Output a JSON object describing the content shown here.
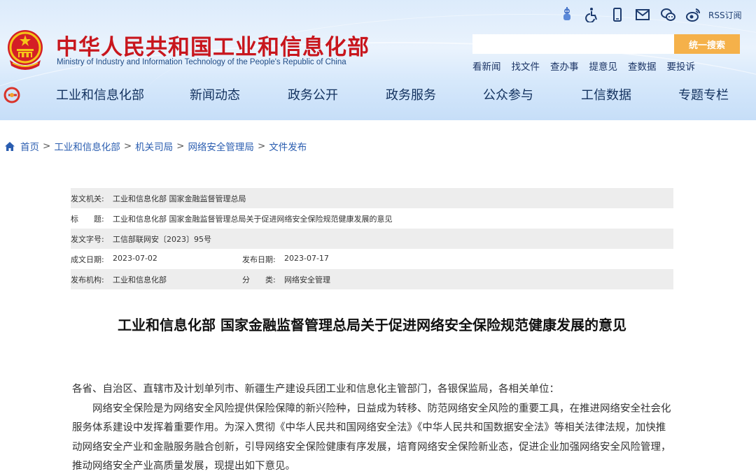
{
  "header": {
    "site_title": "中华人民共和国工业和信息化部",
    "site_subtitle": "Ministry of Industry and Information Technology of the People's Republic of China",
    "top_icons": [
      "robot-icon",
      "accessibility-icon",
      "mobile-icon",
      "mail-icon",
      "wechat-icon",
      "weibo-icon"
    ],
    "rss_label": "RSS订阅",
    "search": {
      "placeholder": "",
      "button_label": "统一搜索"
    },
    "quick_links": [
      "看新闻",
      "找文件",
      "查办事",
      "提意见",
      "查数据",
      "要投诉"
    ]
  },
  "nav": {
    "items": [
      "工业和信息化部",
      "新闻动态",
      "政务公开",
      "政务服务",
      "公众参与",
      "工信数据",
      "专题专栏"
    ]
  },
  "breadcrumb": [
    "首页",
    "工业和信息化部",
    "机关司局",
    "网络安全管理局",
    "文件发布"
  ],
  "meta": {
    "issuer_label": "发文机关:",
    "issuer_value": "工业和信息化部 国家金融监督管理总局",
    "title_label": "标　　题:",
    "title_value": "工业和信息化部 国家金融监督管理总局关于促进网络安全保险规范健康发展的意见",
    "docno_label": "发文字号:",
    "docno_value": "工信部联网安〔2023〕95号",
    "created_label": "成文日期:",
    "created_value": "2023-07-02",
    "published_label": "发布日期:",
    "published_value": "2023-07-17",
    "org_label": "发布机构:",
    "org_value": "工业和信息化部",
    "category_label": "分　　类:",
    "category_value": "网络安全管理"
  },
  "article": {
    "title": "工业和信息化部 国家金融监督管理总局关于促进网络安全保险规范健康发展的意见",
    "salutation": "各省、自治区、直辖市及计划单列市、新疆生产建设兵团工业和信息化主管部门，各银保监局，各相关单位：",
    "paragraph1": "网络安全保险是为网络安全风险提供保险保障的新兴险种，日益成为转移、防范网络安全风险的重要工具，在推进网络安全社会化服务体系建设中发挥着重要作用。为深入贯彻《中华人民共和国网络安全法》《中华人民共和国数据安全法》等相关法律法规，加快推动网络安全产业和金融服务融合创新，引导网络安全保险健康有序发展，培育网络安全保险新业态，促进企业加强网络安全风险管理，推动网络安全产业高质量发展，现提出如下意见。"
  },
  "colors": {
    "title_red": "#c8161d",
    "nav_text": "#12315e",
    "link_blue": "#2a5db0",
    "search_button": "#f5b14a",
    "meta_shade": "#ededed"
  }
}
